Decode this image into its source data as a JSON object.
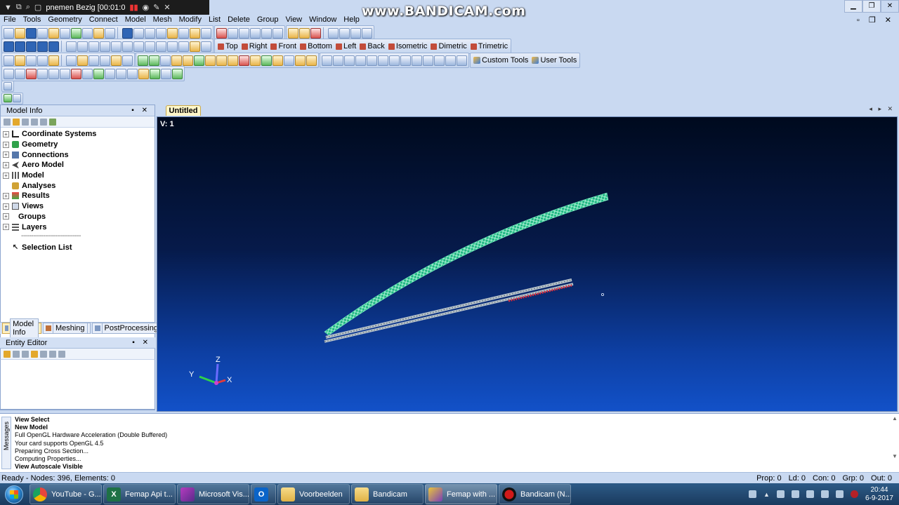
{
  "recorder": {
    "status": "pnemen Bezig [00:01:0"
  },
  "watermark": "www.BANDICAM.com",
  "menu": [
    "File",
    "Tools",
    "Geometry",
    "Connect",
    "Model",
    "Mesh",
    "Modify",
    "List",
    "Delete",
    "Group",
    "View",
    "Window",
    "Help"
  ],
  "view_toolbar": [
    "Top",
    "Right",
    "Front",
    "Bottom",
    "Left",
    "Back",
    "Isometric",
    "Dimetric",
    "Trimetric"
  ],
  "custom_toolbar": {
    "custom": "Custom Tools",
    "user": "User Tools"
  },
  "model_info": {
    "title": "Model Info",
    "items": [
      {
        "label": "Coordinate Systems",
        "expandable": true
      },
      {
        "label": "Geometry",
        "expandable": true
      },
      {
        "label": "Connections",
        "expandable": true
      },
      {
        "label": "Aero Model",
        "expandable": true
      },
      {
        "label": "Model",
        "expandable": true
      },
      {
        "label": "Analyses",
        "expandable": false
      },
      {
        "label": "Results",
        "expandable": true
      },
      {
        "label": "Views",
        "expandable": true
      },
      {
        "label": "Groups",
        "expandable": true
      },
      {
        "label": "Layers",
        "expandable": true
      }
    ],
    "divider": "------------------------------",
    "selection_list": "Selection List"
  },
  "panel_tabs": [
    "Model Info",
    "Meshing",
    "PostProcessing"
  ],
  "entity_editor": {
    "title": "Entity Editor"
  },
  "view_tab": "Untitled",
  "viewport": {
    "label": "V: 1",
    "triad": {
      "z": "Z",
      "y": "Y",
      "x": "X"
    }
  },
  "messages": {
    "tab_label": "Messages",
    "lines": [
      {
        "text": "View Select",
        "bold": true
      },
      {
        "text": "New Model",
        "bold": true
      },
      {
        "text": "Full OpenGL Hardware Acceleration (Double Buffered)",
        "bold": false
      },
      {
        "text": "Your card supports OpenGL 4.5",
        "bold": false
      },
      {
        "text": "Preparing Cross Section...",
        "bold": false
      },
      {
        "text": "Computing Properties...",
        "bold": false
      },
      {
        "text": "View Autoscale Visible",
        "bold": true
      }
    ]
  },
  "status": {
    "left": "Ready - Nodes: 396,  Elements: 0",
    "right": [
      "Prop: 0",
      "Ld: 0",
      "Con: 0",
      "Grp: 0",
      "Out: 0"
    ]
  },
  "taskbar": {
    "items": [
      {
        "label": "YouTube - G...",
        "icon": "chrome-icon",
        "color": "#e8453c"
      },
      {
        "label": "Femap Api t...",
        "icon": "excel-icon",
        "color": "#1e7145"
      },
      {
        "label": "Microsoft Vis...",
        "icon": "visual-studio-icon",
        "color": "#b53cbf"
      },
      {
        "label": "",
        "icon": "outlook-icon",
        "color": "#0a64c8"
      },
      {
        "label": "Voorbeelden",
        "icon": "folder-icon",
        "color": "#e9c46a"
      },
      {
        "label": "Bandicam",
        "icon": "folder-icon",
        "color": "#e9c46a"
      },
      {
        "label": "Femap with ...",
        "icon": "femap-icon",
        "color": "#d9b43a"
      },
      {
        "label": "Bandicam (N...",
        "icon": "bandicam-icon",
        "color": "#d11a1a"
      }
    ],
    "clock": {
      "time": "20:44",
      "date": "6-9-2017"
    }
  }
}
